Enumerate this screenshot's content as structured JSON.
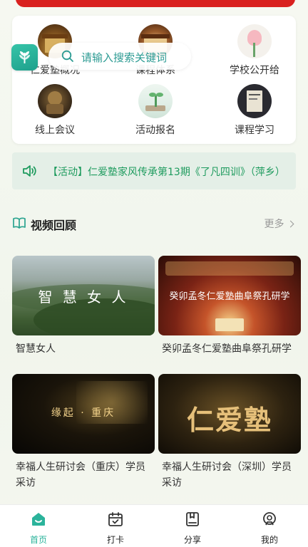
{
  "quick_menu": {
    "row1": [
      {
        "label": "仁爱塾概况",
        "icon": "temple-icon"
      },
      {
        "label": "课程体系",
        "icon": "hall-icon"
      },
      {
        "label": "学校公开给",
        "icon": "lily-icon"
      }
    ],
    "row2": [
      {
        "label": "线上会议",
        "icon": "lion-statue-icon"
      },
      {
        "label": "活动报名",
        "icon": "sprout-icon"
      },
      {
        "label": "课程学习",
        "icon": "book-icon"
      }
    ]
  },
  "search": {
    "placeholder": "请输入搜索关键词"
  },
  "notice": {
    "text": "【活动】仁爱塾家风传承第13期《了凡四训》（萍乡）",
    "icon": "speaker-icon"
  },
  "video_section": {
    "title": "视频回顾",
    "more": "更多",
    "icon": "book-open-icon",
    "items": [
      {
        "caption": "智慧女人",
        "cover_text": "智 慧 女 人"
      },
      {
        "caption": "癸卯孟冬仁爱塾曲阜祭孔研学",
        "cover_text": "癸卯孟冬仁爱塾曲阜祭孔研学"
      },
      {
        "caption": "幸福人生研讨会（重庆）学员采访",
        "cover_text": "缘起 · 重庆"
      },
      {
        "caption": "幸福人生研讨会（深圳）学员采访",
        "cover_text": "仁爱塾"
      }
    ]
  },
  "tabbar": {
    "items": [
      {
        "label": "首页",
        "icon": "home-icon",
        "active": true
      },
      {
        "label": "打卡",
        "icon": "calendar-check-icon",
        "active": false
      },
      {
        "label": "分享",
        "icon": "share-book-icon",
        "active": false
      },
      {
        "label": "我的",
        "icon": "profile-icon",
        "active": false
      }
    ]
  },
  "colors": {
    "accent": "#2bb39b",
    "notice_text": "#1e9b5e",
    "banner_red": "#d9211f"
  }
}
